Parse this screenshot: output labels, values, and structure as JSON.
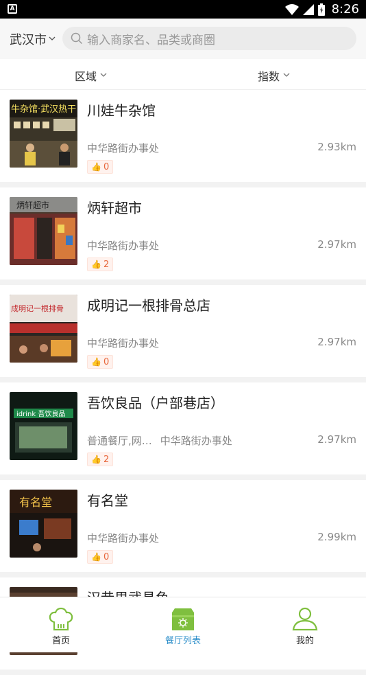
{
  "status_bar": {
    "time": "8:26"
  },
  "header": {
    "city": "武汉市",
    "search_placeholder": "输入商家名、品类或商圈"
  },
  "filters": [
    {
      "label": "区域"
    },
    {
      "label": "指数"
    }
  ],
  "restaurants": [
    {
      "name": "川娃牛杂馆",
      "tags": "",
      "area": "中华路街办事处",
      "distance": "2.93km",
      "likes": "0",
      "sign": "牛杂馆·武汉热干"
    },
    {
      "name": "炳轩超市",
      "tags": "",
      "area": "中华路街办事处",
      "distance": "2.97km",
      "likes": "2",
      "sign": "炳轩超市"
    },
    {
      "name": "成明记一根排骨总店",
      "tags": "",
      "area": "中华路街办事处",
      "distance": "2.97km",
      "likes": "0",
      "sign": "成明记一根排骨"
    },
    {
      "name": "吾饮良品（户部巷店）",
      "tags": "普通餐厅,网…",
      "area": "中华路街办事处",
      "distance": "2.97km",
      "likes": "2",
      "sign": "idrink 吾饮良品"
    },
    {
      "name": "有名堂",
      "tags": "",
      "area": "中华路街办事处",
      "distance": "2.99km",
      "likes": "0",
      "sign": "有名堂"
    },
    {
      "name": "汉巷里武昌鱼",
      "tags": "",
      "area": "",
      "distance": "",
      "likes": "",
      "sign": ""
    }
  ],
  "tabbar": [
    {
      "label": "首页",
      "icon": "chef-hat-icon"
    },
    {
      "label": "餐厅列表",
      "icon": "restaurant-icon",
      "active": true
    },
    {
      "label": "我的",
      "icon": "user-icon"
    }
  ],
  "colors": {
    "accent_green": "#7fbf3f",
    "active_blue": "#2e8fca",
    "like_orange": "#e8663a"
  }
}
